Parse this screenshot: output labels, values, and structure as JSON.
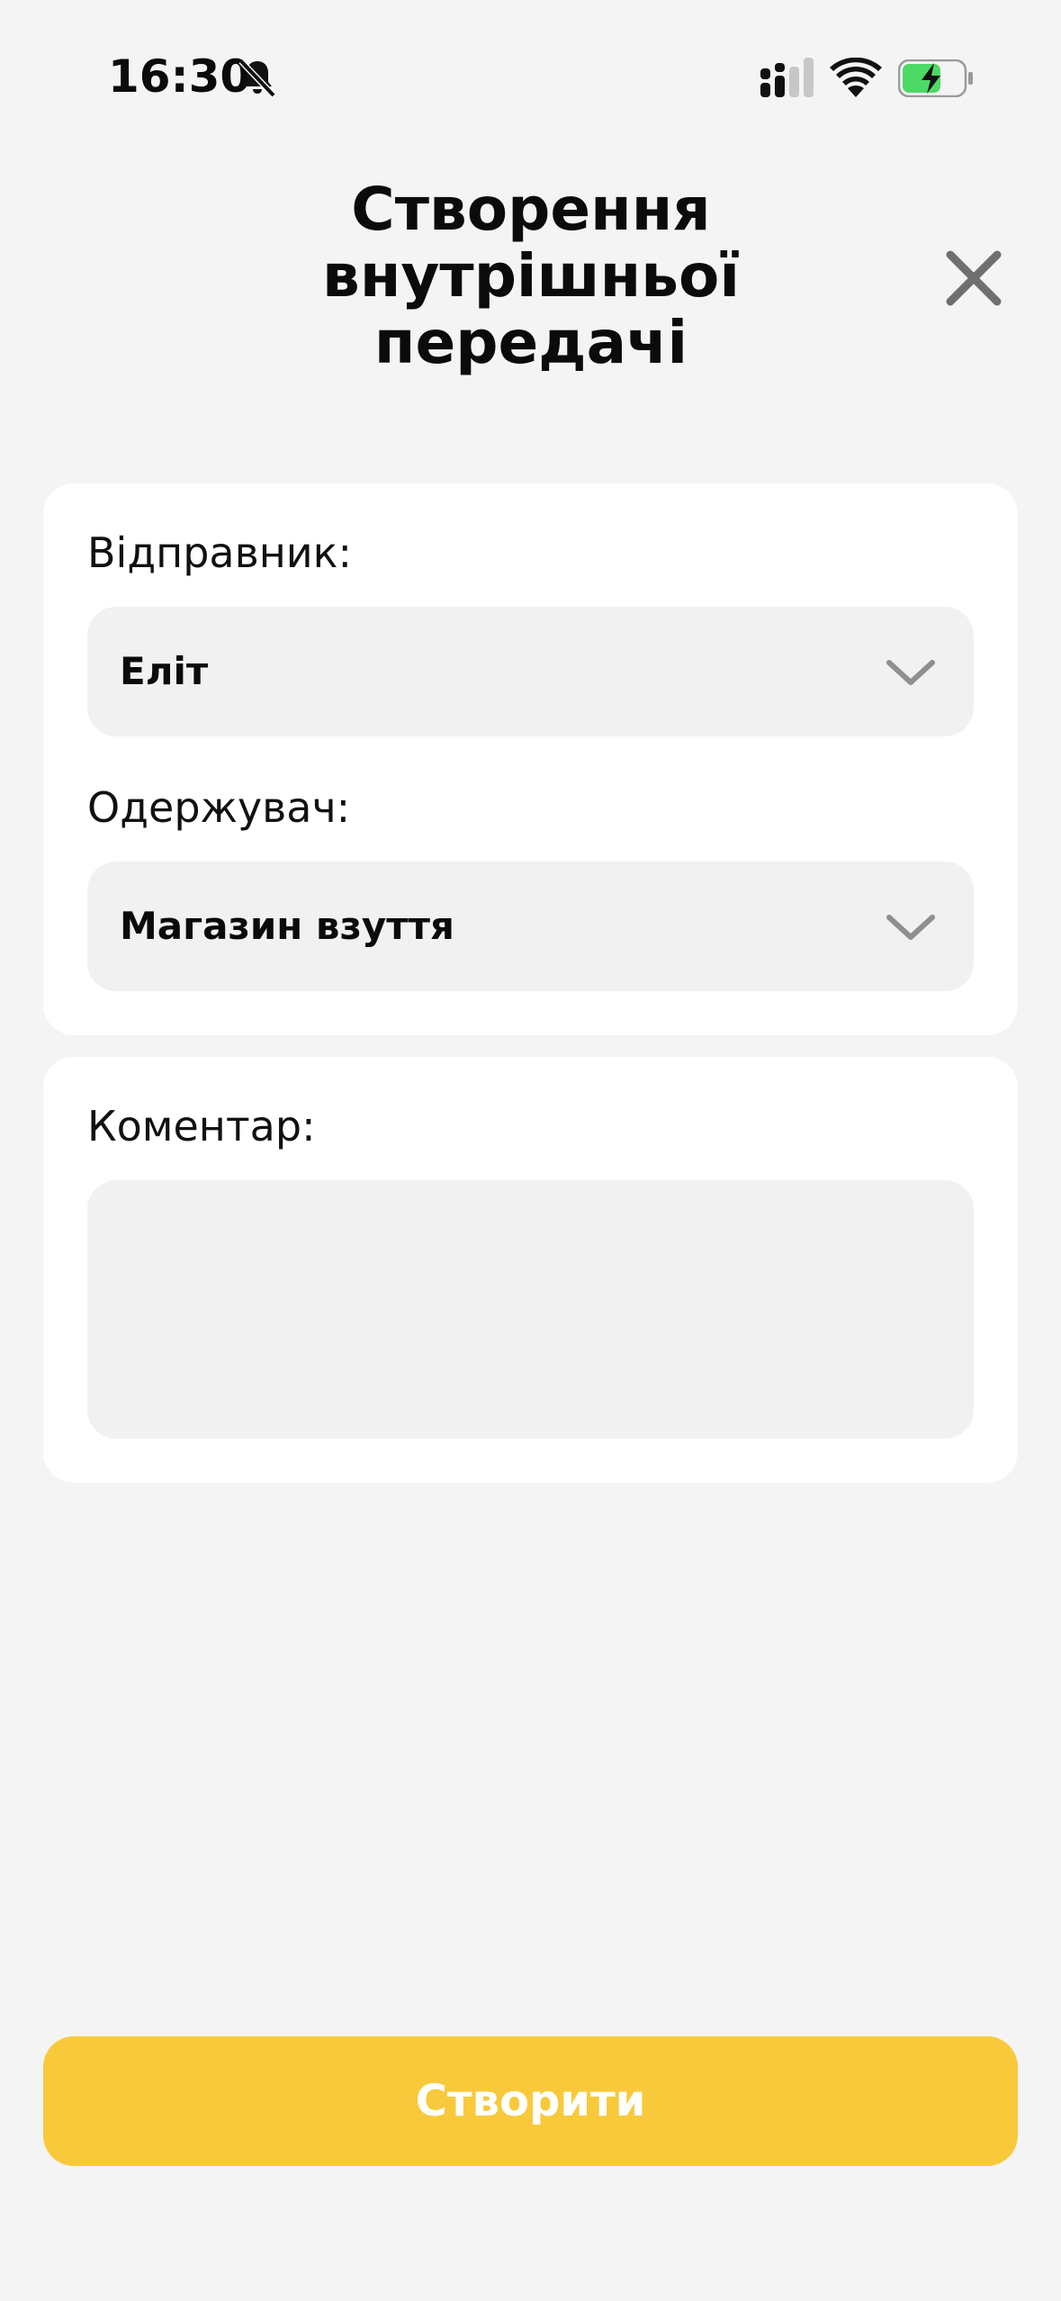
{
  "status_bar": {
    "time": "16:30",
    "icons": [
      "bell-slash-icon",
      "cellular-signal-icon",
      "wifi-icon",
      "battery-charging-icon"
    ],
    "battery_color": "#4cd964"
  },
  "header": {
    "title_lines": [
      "Створення",
      "внутрішньої",
      "передачі"
    ],
    "close_icon": "close-icon"
  },
  "form": {
    "sender": {
      "label": "Відправник:",
      "value": "Еліт"
    },
    "recipient": {
      "label": "Одержувач:",
      "value": "Магазин взуття"
    },
    "comment": {
      "label": "Коментар:",
      "value": ""
    }
  },
  "actions": {
    "create_label": "Створити",
    "create_color": "#f8c93a"
  }
}
